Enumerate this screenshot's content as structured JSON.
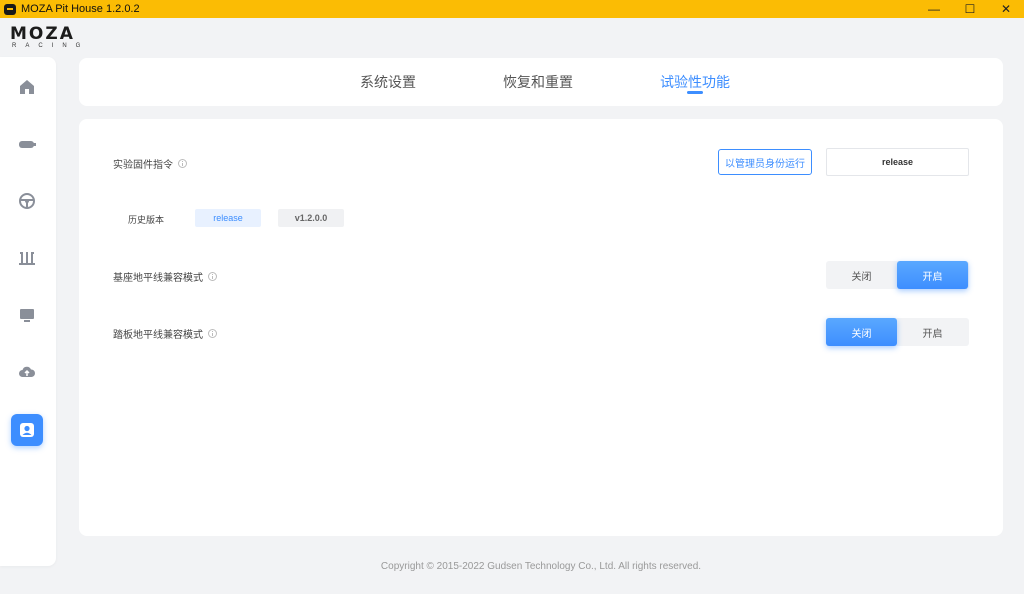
{
  "window": {
    "title": "MOZA Pit House 1.2.0.2",
    "minimize_label": "—",
    "maximize_label": "☐",
    "close_label": "✕"
  },
  "logo": {
    "main": "MOZA",
    "sub": "RACING"
  },
  "sidebar": {
    "items": [
      {
        "icon": "home-icon",
        "active": false
      },
      {
        "icon": "wheelbase-icon",
        "active": false
      },
      {
        "icon": "steering-wheel-icon",
        "active": false
      },
      {
        "icon": "pedals-icon",
        "active": false
      },
      {
        "icon": "dashboard-icon",
        "active": false
      },
      {
        "icon": "cloud-upload-icon",
        "active": false
      },
      {
        "icon": "user-icon",
        "active": true
      }
    ]
  },
  "tabs": [
    {
      "label": "系统设置",
      "active": false
    },
    {
      "label": "恢复和重置",
      "active": false
    },
    {
      "label": "试验性功能",
      "active": true
    }
  ],
  "firmware": {
    "label": "实验固件指令",
    "admin_button": "以管理员身份运行",
    "channel_value": "release"
  },
  "history": {
    "label": "历史版本",
    "versions": [
      "release",
      "v1.2.0.0"
    ],
    "selected": "release"
  },
  "base_horizon": {
    "label": "基座地平线兼容模式",
    "off_label": "关闭",
    "on_label": "开启",
    "value": "开启"
  },
  "pedal_horizon": {
    "label": "踏板地平线兼容模式",
    "off_label": "关闭",
    "on_label": "开启",
    "value": "关闭"
  },
  "footer": {
    "copyright": "Copyright © 2015-2022 Gudsen Technology Co., Ltd. All rights reserved."
  },
  "colors": {
    "title_bar": "#fbbc04",
    "accent": "#3d8eff",
    "background": "#f2f3f5"
  }
}
